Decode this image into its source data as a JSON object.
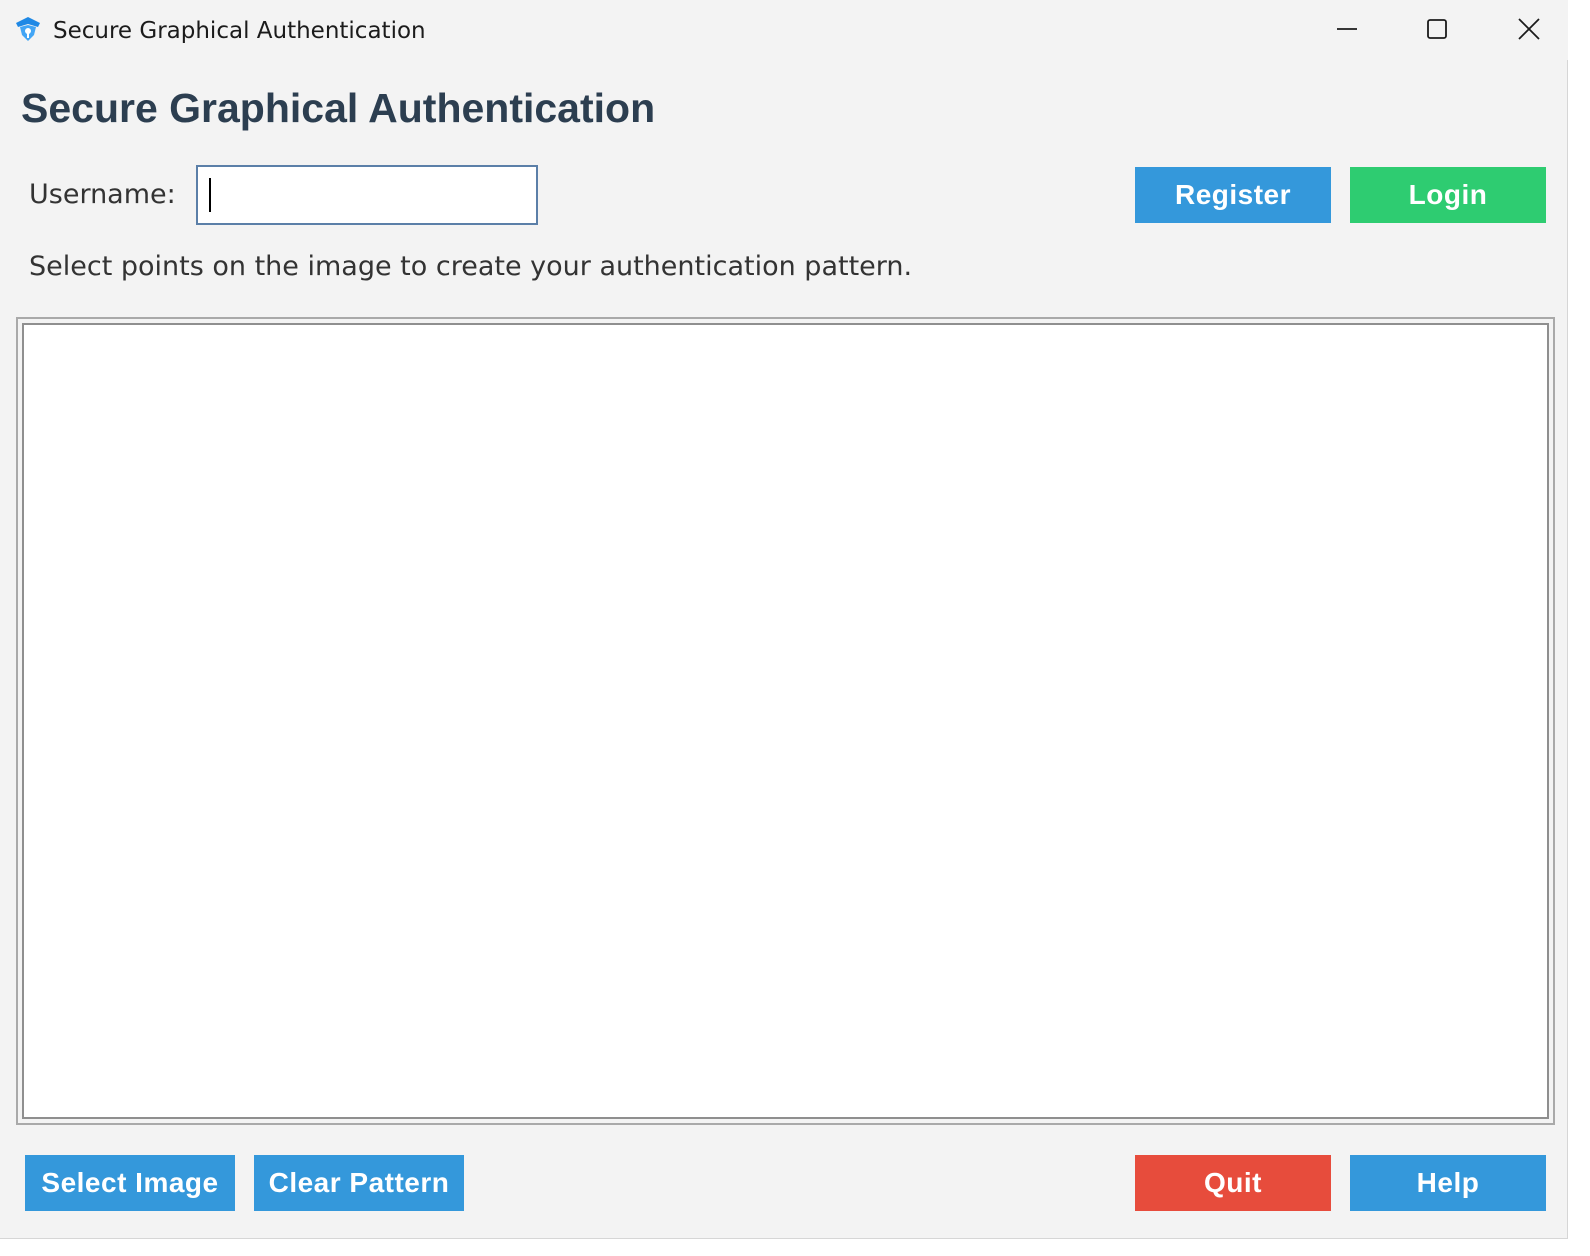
{
  "window": {
    "title": "Secure Graphical Authentication",
    "icon": "shield-app-icon",
    "controls": [
      "minimize-icon",
      "maximize-icon",
      "close-icon"
    ]
  },
  "header": {
    "heading": "Secure Graphical Authentication"
  },
  "form": {
    "username_label": "Username:",
    "username_value": "",
    "register_label": "Register",
    "login_label": "Login",
    "instructions": "Select points on the image to create your authentication pattern."
  },
  "footer": {
    "select_image_label": "Select Image",
    "clear_pattern_label": "Clear Pattern",
    "quit_label": "Quit",
    "help_label": "Help"
  },
  "colors": {
    "blue_button": "#3498db",
    "green_button": "#2ecc71",
    "red_button": "#e74c3c",
    "heading_text": "#2c3e50",
    "window_bg": "#f3f3f3"
  }
}
